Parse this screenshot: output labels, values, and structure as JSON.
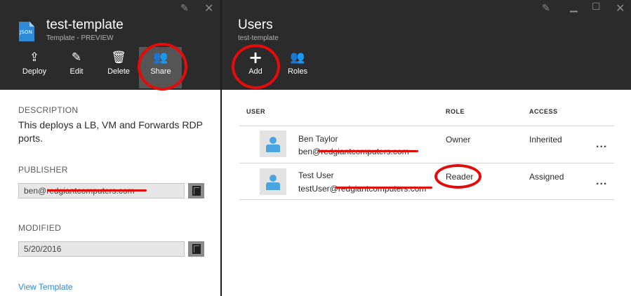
{
  "template_blade": {
    "json_badge": "JSON",
    "title": "test-template",
    "subtitle": "Template - PREVIEW",
    "commands": [
      {
        "label": "Deploy",
        "icon": "upload-icon"
      },
      {
        "label": "Edit",
        "icon": "pencil-icon"
      },
      {
        "label": "Delete",
        "icon": "trash-icon"
      },
      {
        "label": "Share",
        "icon": "share-users-icon"
      }
    ],
    "description_label": "DESCRIPTION",
    "description": "This deploys a LB, VM and Forwards RDP ports.",
    "publisher_label": "PUBLISHER",
    "publisher_value": "ben@redgiantcomputers.com",
    "modified_label": "MODIFIED",
    "modified_value": "5/20/2016",
    "view_link": "View Template"
  },
  "users_blade": {
    "title": "Users",
    "subtitle": "test-template",
    "commands": [
      {
        "label": "Add",
        "icon": "plus-icon"
      },
      {
        "label": "Roles",
        "icon": "roles-icon"
      }
    ],
    "columns": [
      "USER",
      "ROLE",
      "ACCESS"
    ],
    "rows": [
      {
        "name": "Ben Taylor",
        "email": "ben@redgiantcomputers.com",
        "role": "Owner",
        "access": "Inherited",
        "more": "..."
      },
      {
        "name": "Test User",
        "email": "testUser@redgiantcomputers.com",
        "role": "Reader",
        "access": "Assigned",
        "more": "..."
      }
    ]
  },
  "window_controls": {
    "pin": "pin-icon",
    "close": "close-icon",
    "maximize": "maximize-icon",
    "minimize": "minimize-icon"
  },
  "colors": {
    "header_bg": "#2b2b2b",
    "accent": "#2a8ad4",
    "annotation_red": "#e40b0b",
    "selected_cmd": "#555555"
  }
}
